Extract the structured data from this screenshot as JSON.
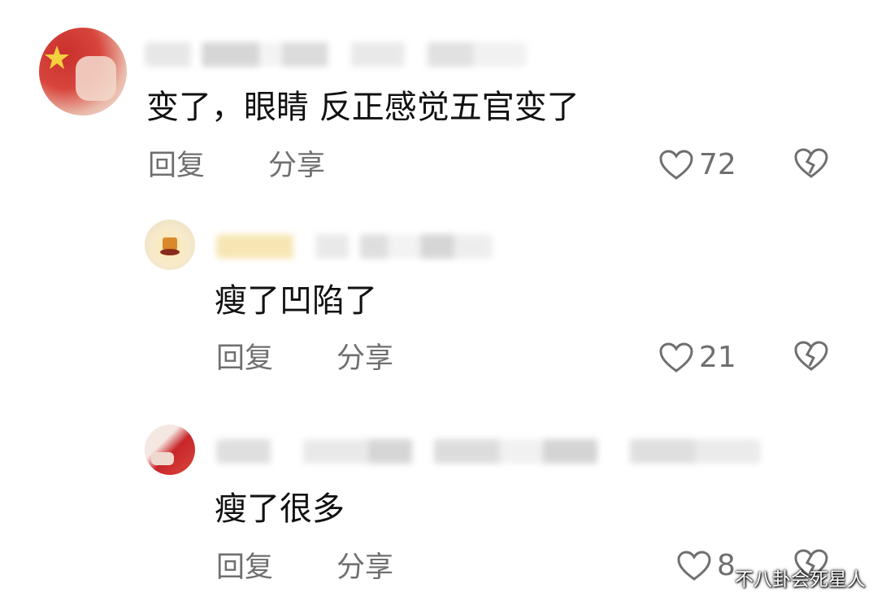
{
  "comments": [
    {
      "text": "变了，眼睛 反正感觉五官变了",
      "reply_label": "回复",
      "share_label": "分享",
      "likes": "72"
    },
    {
      "text": "瘦了凹陷了",
      "reply_label": "回复",
      "share_label": "分享",
      "likes": "21"
    },
    {
      "text": "瘦了很多",
      "reply_label": "回复",
      "share_label": "分享",
      "likes": "8"
    }
  ],
  "watermark": "不八卦会死星人",
  "colors": {
    "text": "#111111",
    "secondary": "#6f6f6f",
    "background": "#ffffff"
  }
}
